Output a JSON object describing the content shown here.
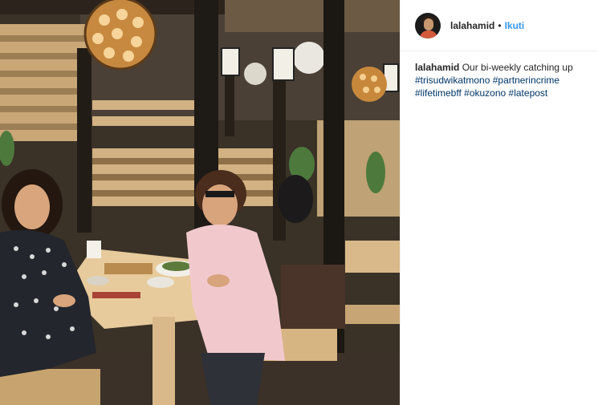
{
  "post": {
    "username": "lalahamid",
    "separator": "•",
    "follow_label": "Ikuti",
    "caption_user": "lalahamid",
    "caption_text": "Our bi-weekly catching up",
    "hashtags": [
      "#trisudwikatmono",
      "#partnerincrime",
      "#lifetimebff",
      "#okuzono",
      "#latepost"
    ]
  },
  "colors": {
    "follow_blue": "#3897f0",
    "hashtag_blue": "#003569",
    "text": "#262626"
  }
}
